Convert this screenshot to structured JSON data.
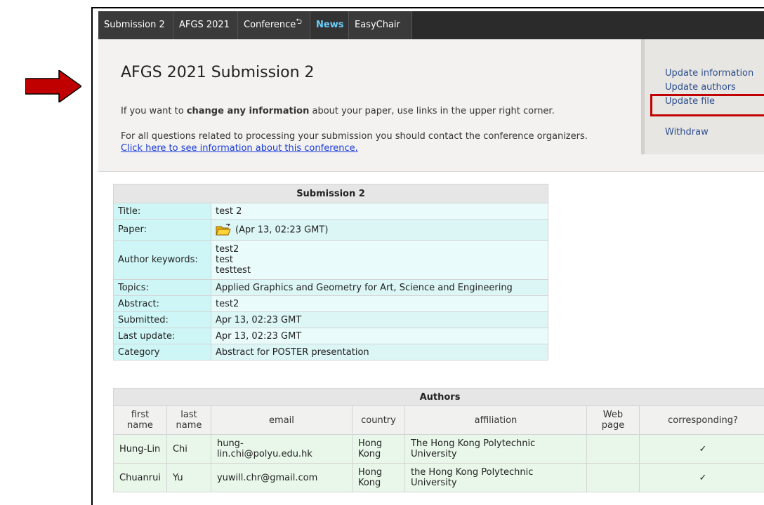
{
  "colors": {
    "arrow": "#c00000",
    "nav_bg": "#2b2b2b",
    "nav_active": "#6ad0ff",
    "highlight_box": "#c00000",
    "link": "#1a3cd6"
  },
  "nav": {
    "items": [
      {
        "label": "Submission 2"
      },
      {
        "label": "AFGS 2021"
      },
      {
        "label": "Conference",
        "icon": "return-arrow-icon"
      },
      {
        "label": "News",
        "active": true
      },
      {
        "label": "EasyChair"
      }
    ]
  },
  "header": {
    "title": "AFGS 2021 Submission 2",
    "p1_pre": "If you want to ",
    "p1_bold": "change any information",
    "p1_post": " about your paper, use links in the upper right corner.",
    "p2": "For all questions related to processing your submission you should contact the conference organizers.",
    "link": "Click here to see information about this conference."
  },
  "sidebar": {
    "update_information": "Update information",
    "update_authors": "Update authors",
    "update_file": "Update file",
    "withdraw": "Withdraw"
  },
  "submission": {
    "heading": "Submission 2",
    "rows": {
      "title": {
        "label": "Title:",
        "value": "test 2"
      },
      "paper": {
        "label": "Paper:",
        "value": "(Apr 13, 02:23 GMT)",
        "icon": "folder-icon"
      },
      "keywords": {
        "label": "Author keywords:",
        "values": [
          "test2",
          "test",
          "testtest"
        ]
      },
      "topics": {
        "label": "Topics:",
        "value": "Applied Graphics and Geometry for Art, Science and Engineering"
      },
      "abstract": {
        "label": "Abstract:",
        "value": "test2"
      },
      "submitted": {
        "label": "Submitted:",
        "value": "Apr 13, 02:23 GMT"
      },
      "last_update": {
        "label": "Last update:",
        "value": "Apr 13, 02:23 GMT"
      },
      "category": {
        "label": "Category",
        "value": "Abstract for POSTER presentation"
      }
    }
  },
  "authors": {
    "heading": "Authors",
    "columns": {
      "first": [
        "first",
        "name"
      ],
      "last": [
        "last",
        "name"
      ],
      "email": "email",
      "country": "country",
      "affiliation": "affiliation",
      "web": [
        "Web",
        "page"
      ],
      "corresponding": "corresponding?"
    },
    "rows": [
      {
        "first": "Hung-Lin",
        "last": "Chi",
        "email": [
          "hung-",
          "lin.chi@polyu.edu.hk"
        ],
        "country": [
          "Hong",
          "Kong"
        ],
        "affiliation": [
          "The Hong Kong Polytechnic",
          "University"
        ],
        "web": "",
        "corresponding": "✓"
      },
      {
        "first": "Chuanrui",
        "last": "Yu",
        "email": [
          "yuwill.chr@gmail.com"
        ],
        "country": [
          "Hong",
          "Kong"
        ],
        "affiliation": [
          "the Hong Kong Polytechnic",
          "University"
        ],
        "web": "",
        "corresponding": "✓"
      }
    ]
  }
}
